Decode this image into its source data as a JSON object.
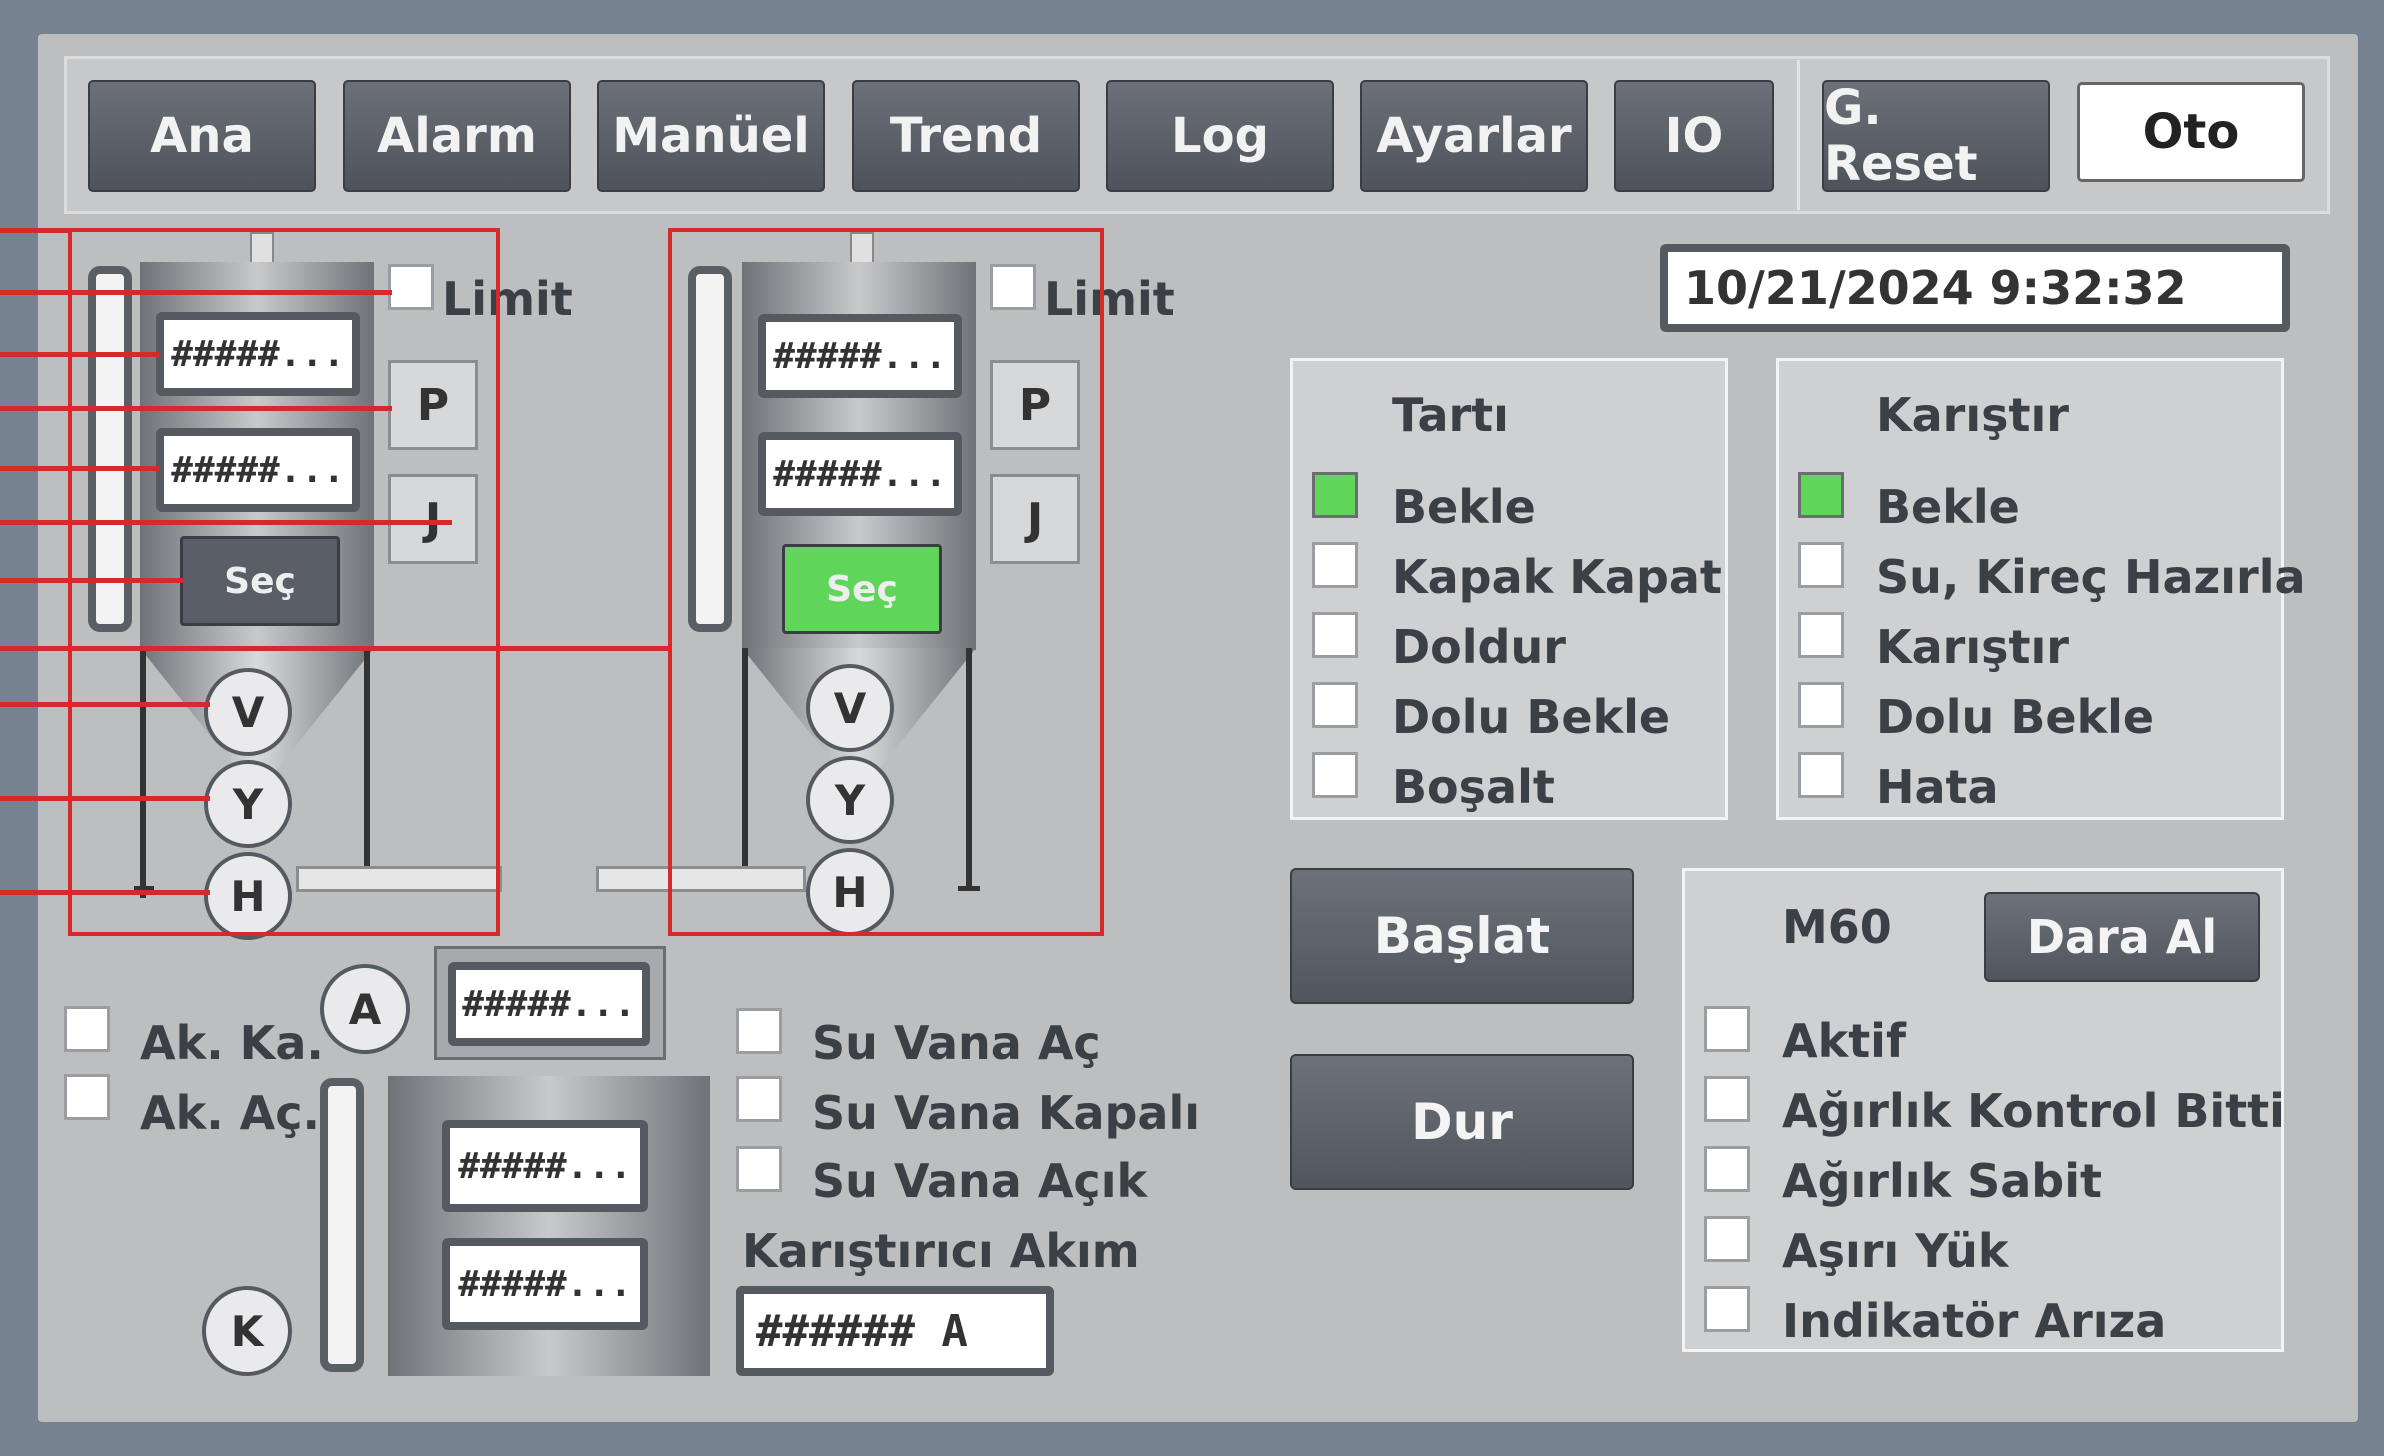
{
  "toolbar": {
    "buttons": [
      "Ana",
      "Alarm",
      "Manüel",
      "Trend",
      "Log",
      "Ayarlar",
      "IO",
      "G. Reset"
    ],
    "mode_label": "Oto"
  },
  "datetime": "10/21/2024 9:32:32",
  "silo1": {
    "limit_label": "Limit",
    "field1": "#####...",
    "field2": "#####...",
    "p_label": "P",
    "j_label": "J",
    "sec_label": "Seç",
    "sec_active": false,
    "valves": [
      "V",
      "Y",
      "H"
    ]
  },
  "silo2": {
    "limit_label": "Limit",
    "field1": "#####...",
    "field2": "#####...",
    "p_label": "P",
    "j_label": "J",
    "sec_label": "Seç",
    "sec_active": true,
    "valves": [
      "V",
      "Y",
      "H"
    ]
  },
  "hopper": {
    "ak_ka_label": "Ak. Ka.",
    "ak_ac_label": "Ak. Aç.",
    "a_label": "A",
    "a_field": "#####...",
    "field1": "#####...",
    "field2": "#####...",
    "k_label": "K"
  },
  "water": {
    "items": [
      "Su Vana Aç",
      "Su Vana Kapalı",
      "Su Vana Açık"
    ],
    "current_label": "Karıştırıcı Akım",
    "current_value": "###### A"
  },
  "tarti": {
    "title": "Tartı",
    "states": [
      {
        "label": "Bekle",
        "active": true
      },
      {
        "label": "Kapak Kapat",
        "active": false
      },
      {
        "label": "Doldur",
        "active": false
      },
      {
        "label": "Dolu Bekle",
        "active": false
      },
      {
        "label": "Boşalt",
        "active": false
      }
    ]
  },
  "karistir": {
    "title": "Karıştır",
    "states": [
      {
        "label": "Bekle",
        "active": true
      },
      {
        "label": "Su, Kireç Hazırla",
        "active": false
      },
      {
        "label": "Karıştır",
        "active": false
      },
      {
        "label": "Dolu Bekle",
        "active": false
      },
      {
        "label": "Hata",
        "active": false
      }
    ]
  },
  "controls": {
    "start_label": "Başlat",
    "stop_label": "Dur"
  },
  "m60": {
    "title": "M60",
    "tare_label": "Dara Al",
    "items": [
      "Aktif",
      "Ağırlık Kontrol Bitti",
      "Ağırlık Sabit",
      "Aşırı Yük",
      "Indikatör Arıza"
    ]
  },
  "colors": {
    "active_green": "#5fd65a",
    "annotation_red": "#d62a2a",
    "button_gray": "#5a5e66"
  }
}
